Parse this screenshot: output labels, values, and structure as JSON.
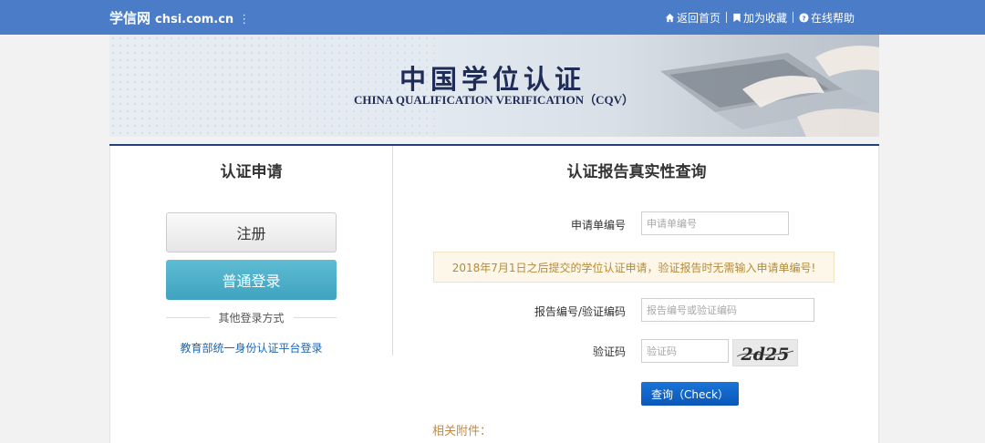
{
  "header": {
    "brand_cn": "学信网",
    "brand_domain": "chsi.com.cn",
    "brand_dots": "⋮",
    "links": [
      {
        "label": "返回首页",
        "icon": "home-icon"
      },
      {
        "label": "加为收藏",
        "icon": "bookmark-icon"
      },
      {
        "label": "在线帮助",
        "icon": "help-icon"
      }
    ]
  },
  "banner": {
    "title": "中国学位认证",
    "subtitle": "CHINA QUALIFICATION VERIFICATION（CQV）"
  },
  "left_panel": {
    "title": "认证申请",
    "register_label": "注册",
    "login_label": "普通登录",
    "other_login_label": "其他登录方式",
    "edu_login_link": "教育部统一身份认证平台登录"
  },
  "right_panel": {
    "title": "认证报告真实性查询",
    "application_no": {
      "label": "申请单编号",
      "placeholder": "申请单编号",
      "value": ""
    },
    "notice": "2018年7月1日之后提交的学位认证申请，验证报告时无需输入申请单编号!",
    "report_no": {
      "label": "报告编号/验证编码",
      "placeholder": "报告编号或验证编码",
      "value": ""
    },
    "captcha": {
      "label": "验证码",
      "placeholder": "验证码",
      "value": "",
      "image_text": "2d25"
    },
    "check_label": "查询（Check）",
    "attachments_label": "相关附件："
  },
  "colors": {
    "topbar": "#4a7cc7",
    "login_button": "#46aac5",
    "check_button": "#0f63c6",
    "notice_bg": "#fcf7e8",
    "notice_text": "#b58b3b",
    "link": "#1a66b3",
    "banner_line": "#23417e"
  }
}
